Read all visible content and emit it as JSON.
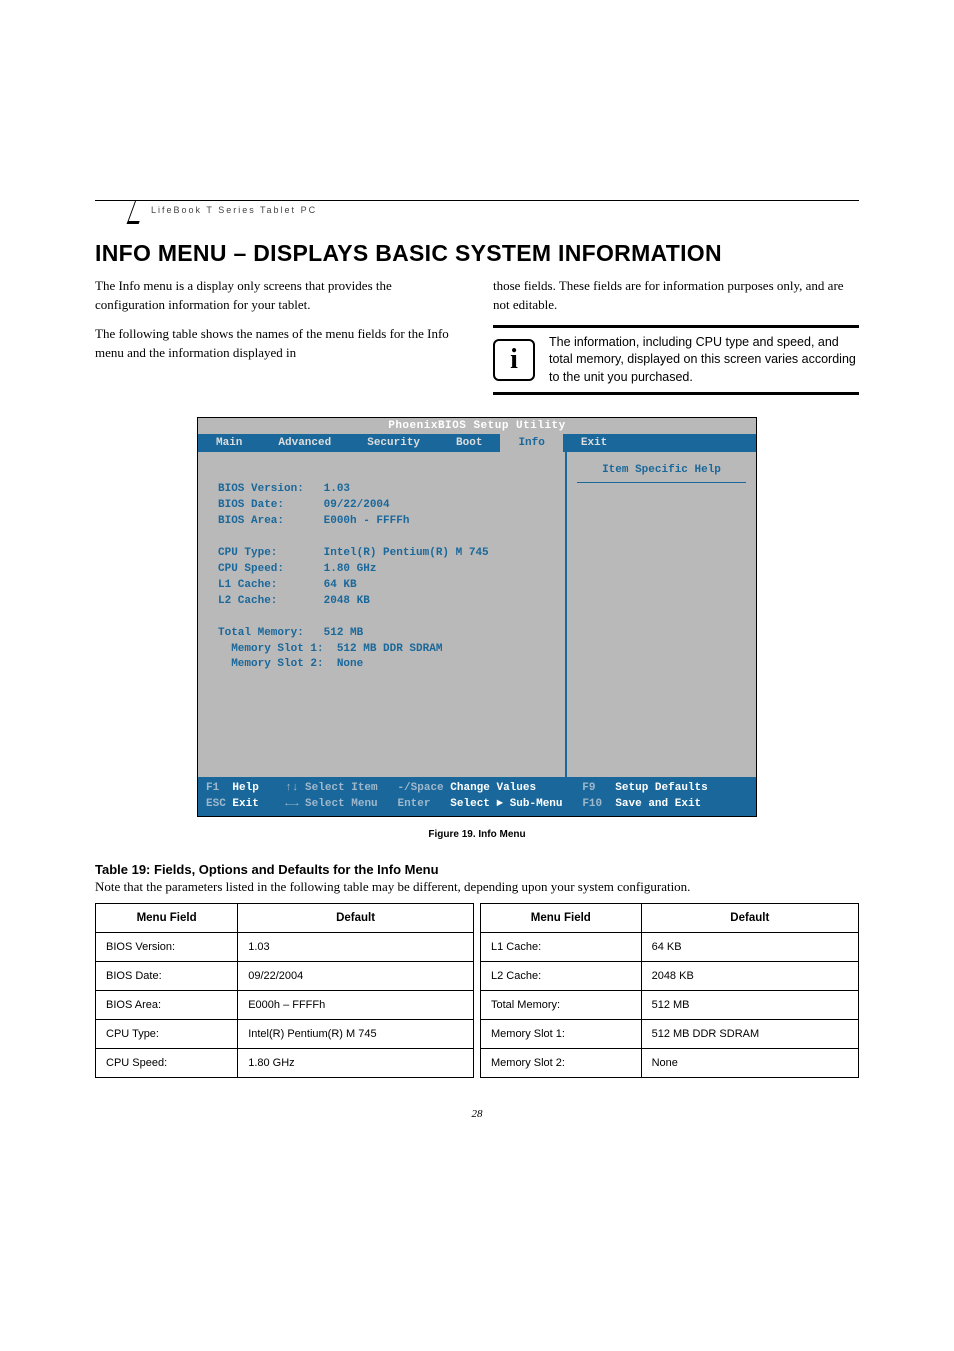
{
  "header": {
    "product_line": "LifeBook T Series Tablet PC"
  },
  "heading": "INFO MENU – DISPLAYS BASIC SYSTEM INFORMATION",
  "intro": {
    "left_p1": "The Info menu is a display only screens that provides the configuration information for your tablet.",
    "left_p2": "The following table shows the names of the menu fields for the Info menu and the information displayed in",
    "right_p1": "those fields. These fields are for information purposes only, and are not editable.",
    "note_glyph": "i",
    "note_text": "The information, including CPU type and speed, and total memory, displayed on this screen varies according to the unit you purchased."
  },
  "bios": {
    "utility_title": "PhoenixBIOS Setup Utility",
    "tabs": {
      "main": "Main",
      "advanced": "Advanced",
      "security": "Security",
      "boot": "Boot",
      "info": "Info",
      "exit": "Exit"
    },
    "help_title": "Item Specific Help",
    "fields": {
      "bios_version_label": "BIOS Version:",
      "bios_version_value": "1.03",
      "bios_date_label": "BIOS Date:",
      "bios_date_value": "09/22/2004",
      "bios_area_label": "BIOS Area:",
      "bios_area_value": "E000h - FFFFh",
      "cpu_type_label": "CPU Type:",
      "cpu_type_value": "Intel(R) Pentium(R) M 745",
      "cpu_speed_label": "CPU Speed:",
      "cpu_speed_value": "1.80 GHz",
      "l1_cache_label": "L1 Cache:",
      "l1_cache_value": "64 KB",
      "l2_cache_label": "L2 Cache:",
      "l2_cache_value": "2048 KB",
      "total_memory_label": "Total Memory:",
      "total_memory_value": "512 MB",
      "slot1_label": "Memory Slot 1:",
      "slot1_value": "512 MB DDR SDRAM",
      "slot2_label": "Memory Slot 2:",
      "slot2_value": "None"
    },
    "footer": {
      "line1_keys_f1": "F1",
      "line1_help": "Help",
      "line1_select_item": "↑↓ Select Item",
      "line1_change": "-/Space",
      "line1_change_txt": "Change Values",
      "line1_f9": "F9",
      "line1_defaults": "Setup Defaults",
      "line2_esc": "ESC",
      "line2_exit": "Exit",
      "line2_select_menu": "←→ Select Menu",
      "line2_enter": "Enter",
      "line2_sub": "Select ► Sub-Menu",
      "line2_f10": "F10",
      "line2_save": "Save and Exit"
    }
  },
  "figure_caption": "Figure 19.   Info Menu",
  "table_title": "Table 19: Fields, Options and Defaults for the Info Menu",
  "table_note": "Note that the parameters listed in the following table may be different, depending upon your system configuration.",
  "defaults_table": {
    "header_field": "Menu Field",
    "header_default": "Default",
    "left_rows": [
      {
        "field": "BIOS Version:",
        "default": "1.03"
      },
      {
        "field": "BIOS Date:",
        "default": "09/22/2004"
      },
      {
        "field": "BIOS Area:",
        "default": "E000h – FFFFh"
      },
      {
        "field": "CPU Type:",
        "default": "Intel(R) Pentium(R) M 745"
      },
      {
        "field": "CPU Speed:",
        "default": "1.80 GHz"
      }
    ],
    "right_rows": [
      {
        "field": "L1 Cache:",
        "default": "64 KB"
      },
      {
        "field": "L2 Cache:",
        "default": "2048 KB"
      },
      {
        "field": "Total Memory:",
        "default": "512 MB"
      },
      {
        "field": "Memory Slot 1:",
        "default": "512 MB DDR SDRAM"
      },
      {
        "field": "Memory Slot 2:",
        "default": "None"
      }
    ]
  },
  "page_number": "28"
}
